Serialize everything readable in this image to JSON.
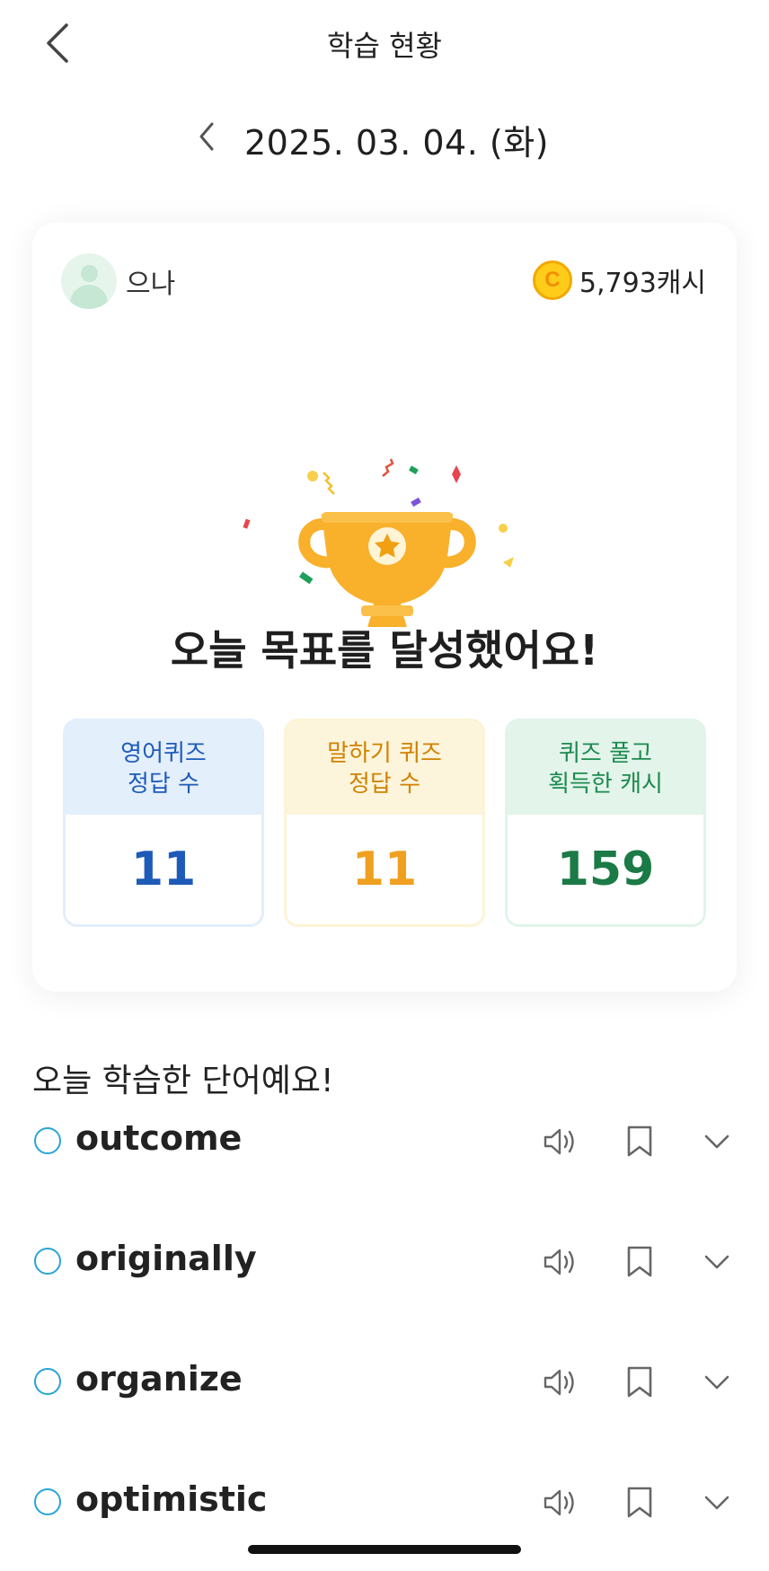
{
  "header": {
    "title": "학습 현황",
    "back_icon": "back-arrow-icon"
  },
  "date_nav": {
    "date": "2025. 03. 04. (화)",
    "prev_icon": "chevron-left-icon"
  },
  "summary_card": {
    "user_name": "으나",
    "coin_symbol": "C",
    "cash": "5,793캐시",
    "achievement": "오늘 목표를 달성했어요!",
    "stats": [
      {
        "label_line1": "영어퀴즈",
        "label_line2": "정답 수",
        "value": "11",
        "color": "#1e5bb8"
      },
      {
        "label_line1": "말하기 퀴즈",
        "label_line2": "정답 수",
        "value": "11",
        "color": "#f0a020"
      },
      {
        "label_line1": "퀴즈 풀고",
        "label_line2": "획득한 캐시",
        "value": "159",
        "color": "#1b7a46"
      }
    ]
  },
  "words_section": {
    "title": "오늘 학습한 단어예요!",
    "words": [
      {
        "word": "outcome"
      },
      {
        "word": "originally"
      },
      {
        "word": "organize"
      },
      {
        "word": "optimistic"
      }
    ]
  },
  "colors": {
    "accent_check": "#2aa4d8",
    "trophy": "#f9b02a"
  }
}
